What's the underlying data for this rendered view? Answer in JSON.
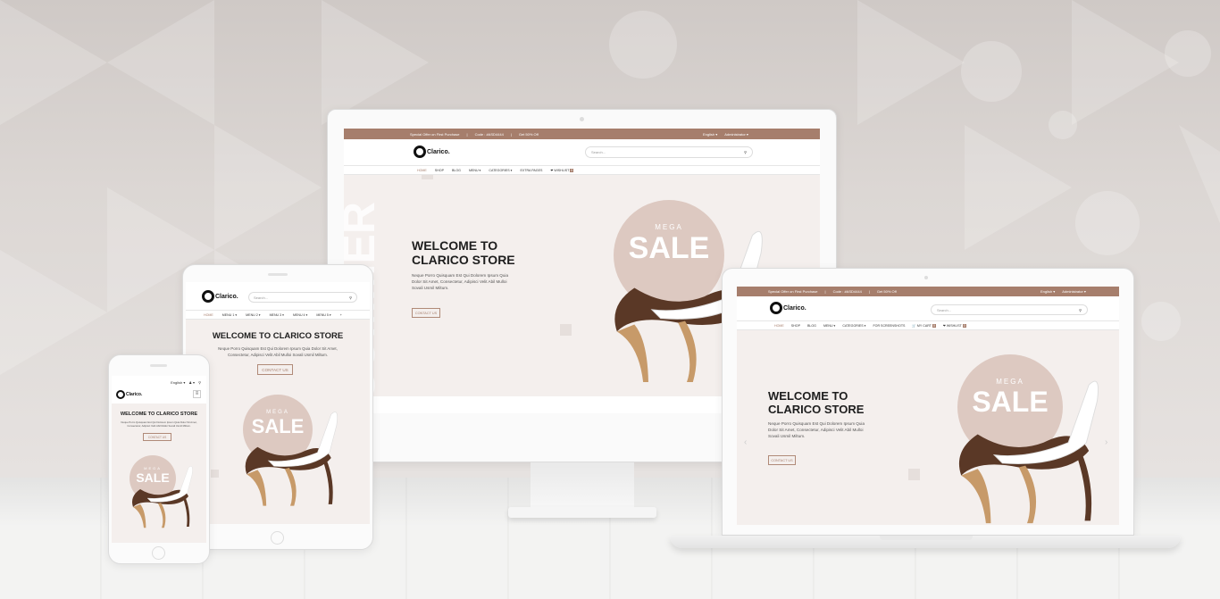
{
  "store": {
    "offer_text": "Special Offer on First Purchase",
    "code_text": "Code : #ASD4444",
    "discount_text": "Get 50% Off",
    "language": "English",
    "account": "Administrator",
    "logo_text": "Clarico.",
    "search_placeholder": "Search...",
    "hero_title_line1": "WELCOME TO",
    "hero_title_line2": "CLARICO STORE",
    "hero_title_full": "WELCOME TO CLARICO STORE",
    "hero_text_line1": "Neque Porro Quisquam Est Qui Dolorem Ipsum Quia",
    "hero_text_line2": "Dolor Sit Amet, Consectetur, Adipisci Velit Abil Mulloi",
    "hero_text_line3": "Sovali Usmil Miltum.",
    "hero_text_full": "Neque Porro Quisquam Est Qui Dolorem Ipsum Quia Dolor Sit Amet, Consectetur, Adipisci Velit Abil Mulloi Sovali Usmil Miltum.",
    "cta_label": "CONTACT US",
    "sale_mega": "MEGA",
    "sale_text": "SALE",
    "vertical_text": "SUMMER"
  },
  "desktop_nav": [
    "HOME",
    "SHOP",
    "BLOG",
    "MENU ▾",
    "CATEGORIES ▾",
    "EXTRA PAGES",
    "❤ WISHLIST"
  ],
  "laptop_nav": [
    "HOME",
    "SHOP",
    "BLOG",
    "MENU ▾",
    "CATEGORIES ▾",
    "FOR SCREENSHOTS",
    "🛒 MY CART",
    "❤ WISHLIST"
  ],
  "tablet_nav": [
    "HOME",
    "MENU 1 ▾",
    "MENU 2 ▾",
    "MENU 3 ▾",
    "MENU 4 ▾",
    "MENU 5 ▾",
    "+"
  ],
  "badge_count": "0",
  "colors": {
    "accent": "#a67e6c",
    "hero_bg": "#f4efed",
    "sale_circle": "#ddc9c1"
  }
}
